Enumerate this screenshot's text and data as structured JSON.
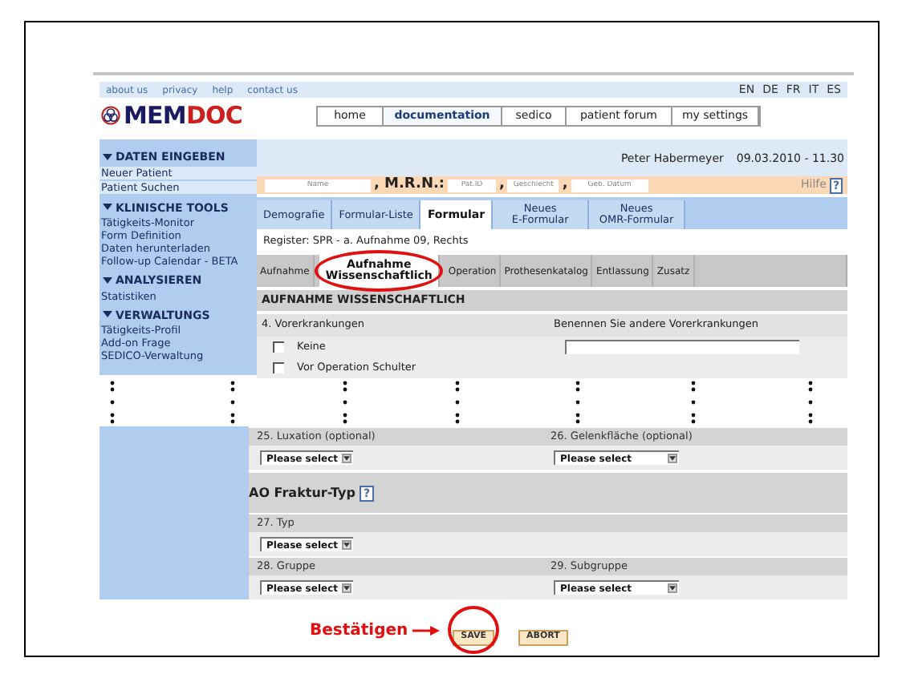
{
  "top_links": [
    "about us",
    "privacy",
    "help",
    "contact us"
  ],
  "languages": [
    "EN",
    "DE",
    "FR",
    "IT",
    "ES"
  ],
  "logo": {
    "first": "MEM",
    "second": "DOC"
  },
  "nav_tabs": [
    {
      "label": "home",
      "selected": false
    },
    {
      "label": "documentation",
      "selected": true
    },
    {
      "label": "sedico",
      "selected": false
    },
    {
      "label": "patient forum",
      "selected": false
    },
    {
      "label": "my settings",
      "selected": false
    }
  ],
  "sidebar": [
    {
      "title": "DATEN EINGEBEN",
      "items": [
        {
          "label": "Neuer Patient",
          "highlighted": true
        },
        {
          "label": "Patient Suchen",
          "highlighted": true
        }
      ]
    },
    {
      "title": "KLINISCHE TOOLS",
      "items": [
        {
          "label": "Tätigkeits-Monitor",
          "highlighted": false
        },
        {
          "label": "Form Definition",
          "highlighted": false
        },
        {
          "label": "Daten herunterladen",
          "highlighted": false
        },
        {
          "label": "Follow-up Calendar - BETA",
          "highlighted": false
        }
      ]
    },
    {
      "title": "ANALYSIEREN",
      "items": [
        {
          "label": "Statistiken",
          "highlighted": false
        }
      ]
    },
    {
      "title": "VERWALTUNGS",
      "items": [
        {
          "label": "Tätigkeits-Profil",
          "highlighted": false
        },
        {
          "label": "Add-on Frage",
          "highlighted": false
        },
        {
          "label": "SEDICO-Verwaltung",
          "highlighted": false
        }
      ]
    }
  ],
  "user_bar": {
    "user": "Peter Habermeyer",
    "datetime": "09.03.2010 - 11.30"
  },
  "patient_bar": {
    "items": [
      {
        "kind": "field",
        "placeholder": "Name"
      },
      {
        "kind": "label",
        "text": ", M.R.N.:"
      },
      {
        "kind": "field",
        "placeholder": "Pat.ID"
      },
      {
        "kind": "label",
        "text": ","
      },
      {
        "kind": "field",
        "placeholder": "Geschlecht"
      },
      {
        "kind": "label",
        "text": ","
      },
      {
        "kind": "field",
        "placeholder": "Geb. Datum"
      }
    ],
    "help": "Hilfe",
    "help_icon": "?"
  },
  "form_tabs": [
    {
      "label": "Demografie",
      "selected": false
    },
    {
      "label": "Formular-Liste",
      "selected": false
    },
    {
      "label": "Formular",
      "selected": true
    },
    {
      "label": "Neues\nE-Formular",
      "selected": false
    },
    {
      "label": "Neues\nOMR-Formular",
      "selected": false
    }
  ],
  "register": "Register: SPR - a. Aufnahme 09, Rechts",
  "sub_tabs": [
    {
      "label": "Aufnahme",
      "selected": false,
      "circled": false
    },
    {
      "label": "Aufnahme\nWissenschaftlich",
      "selected": true,
      "circled": true
    },
    {
      "label": "Operation",
      "selected": false,
      "circled": false
    },
    {
      "label": "Prothesenkatalog",
      "selected": false,
      "circled": false
    },
    {
      "label": "Entlassung",
      "selected": false,
      "circled": false
    },
    {
      "label": "Zusatz",
      "selected": false,
      "circled": false
    }
  ],
  "section_title": "AUFNAHME WISSENSCHAFTLICH",
  "upper_rows": [
    {
      "kind": "labels",
      "left": "4. Vorerkrankungen",
      "right": "Benennen Sie andere Vorerkrankungen"
    },
    {
      "kind": "checkbox_input",
      "label": "Keine",
      "checked": false
    },
    {
      "kind": "checkbox",
      "label": "Vor Operation Schulter",
      "checked": false
    }
  ],
  "lower_rows": [
    {
      "kind": "labels",
      "left": "25. Luxation (optional)",
      "right": "26. Gelenkfläche (optional)"
    },
    {
      "kind": "selects",
      "left": "Please select",
      "right": "Please select"
    },
    {
      "kind": "header",
      "text": "AO Fraktur-Typ",
      "help": "?"
    },
    {
      "kind": "labels",
      "left": "27. Typ"
    },
    {
      "kind": "selects",
      "left": "Please select"
    },
    {
      "kind": "labels",
      "left": "28. Gruppe",
      "right": "29. Subgruppe"
    },
    {
      "kind": "selects",
      "left": "Please select",
      "right": "Please select"
    }
  ],
  "actions": {
    "callout": "Bestätigen",
    "buttons": [
      {
        "label": "SAVE",
        "circled": true
      },
      {
        "label": "ABORT",
        "circled": false
      }
    ]
  }
}
